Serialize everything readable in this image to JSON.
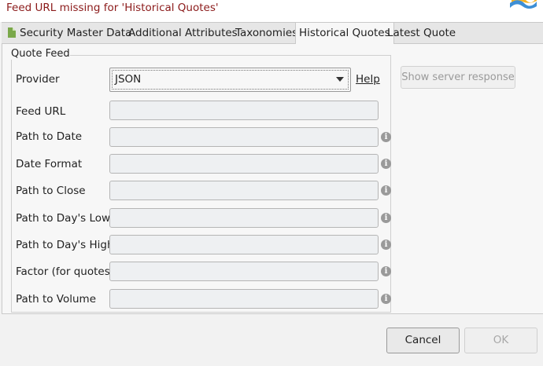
{
  "message": {
    "error": "Feed URL missing for 'Historical Quotes'"
  },
  "tabs": [
    {
      "label": "Security Master Data",
      "icon": "document-icon"
    },
    {
      "label": "Additional Attributes"
    },
    {
      "label": "Taxonomies"
    },
    {
      "label": "Historical Quotes",
      "active": true
    },
    {
      "label": "Latest Quote"
    }
  ],
  "quote_feed": {
    "title": "Quote Feed",
    "provider_label": "Provider",
    "provider_value": "JSON",
    "help_label": "Help",
    "fields": [
      {
        "label": "Feed URL",
        "value": ""
      },
      {
        "label": "Path to Date",
        "value": ""
      },
      {
        "label": "Date Format",
        "value": ""
      },
      {
        "label": "Path to Close",
        "value": ""
      },
      {
        "label": "Path to Day's Low",
        "value": ""
      },
      {
        "label": "Path to Day's High",
        "value": ""
      },
      {
        "label": "Factor (for quotes)",
        "value": ""
      },
      {
        "label": "Path to Volume",
        "value": ""
      }
    ],
    "info_icon": "i"
  },
  "buttons": {
    "server_response": "Show server response",
    "cancel": "Cancel",
    "ok": "OK"
  },
  "colors": {
    "error_text": "#8b1a1a"
  }
}
